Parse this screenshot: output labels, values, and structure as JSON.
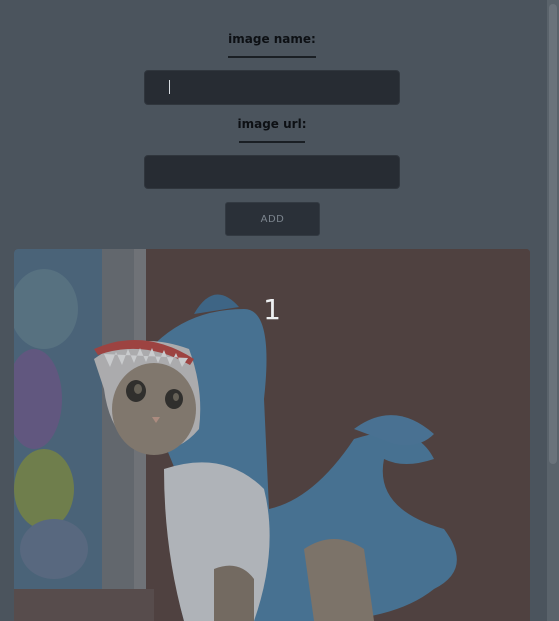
{
  "form": {
    "image_name_label": "image name:",
    "image_name_value": "",
    "image_url_label": "image url:",
    "image_url_value": "",
    "add_button_label": "ADD"
  },
  "gallery": {
    "cards": [
      {
        "number": "1"
      }
    ]
  },
  "colors": {
    "page_background": "#4b545d",
    "input_background": "#272c33",
    "button_background": "#2a3038",
    "label_text": "#0d1014"
  }
}
